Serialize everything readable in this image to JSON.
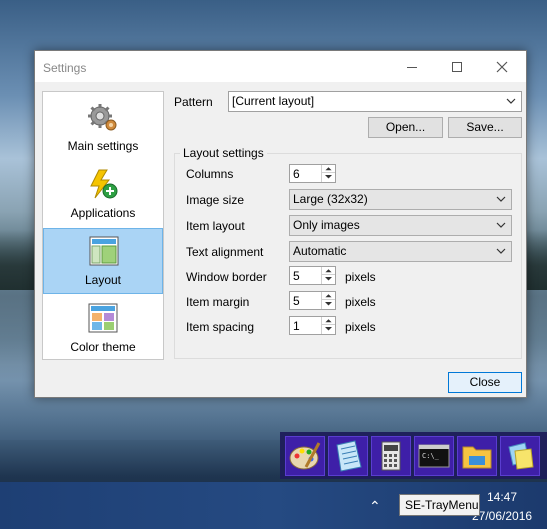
{
  "window": {
    "title": "Settings",
    "minimize_icon": "minimize-icon",
    "maximize_icon": "maximize-icon",
    "close_icon": "close-icon"
  },
  "sidebar": {
    "items": [
      {
        "label": "Main settings",
        "icon": "gears-icon"
      },
      {
        "label": "Applications",
        "icon": "lightning-add-icon"
      },
      {
        "label": "Layout",
        "icon": "layout-icon",
        "selected": true
      },
      {
        "label": "Color theme",
        "icon": "color-palette-icon"
      }
    ]
  },
  "pattern": {
    "label": "Pattern",
    "value": "[Current layout]",
    "open_label": "Open...",
    "save_label": "Save..."
  },
  "layout_settings": {
    "title": "Layout settings",
    "columns": {
      "label": "Columns",
      "value": "6"
    },
    "image_size": {
      "label": "Image size",
      "value": "Large (32x32)"
    },
    "item_layout": {
      "label": "Item layout",
      "value": "Only images"
    },
    "text_alignment": {
      "label": "Text alignment",
      "value": "Automatic"
    },
    "window_border": {
      "label": "Window border",
      "value": "5",
      "unit": "pixels"
    },
    "item_margin": {
      "label": "Item margin",
      "value": "5",
      "unit": "pixels"
    },
    "item_spacing": {
      "label": "Item spacing",
      "value": "1",
      "unit": "pixels"
    }
  },
  "footer": {
    "close_label": "Close"
  },
  "tray_menu": {
    "items": [
      {
        "icon": "paint-palette-icon"
      },
      {
        "icon": "notepad-icon"
      },
      {
        "icon": "calculator-icon"
      },
      {
        "icon": "command-prompt-icon"
      },
      {
        "icon": "file-explorer-icon"
      },
      {
        "icon": "sticky-notes-icon"
      }
    ]
  },
  "taskbar": {
    "time": "14:47",
    "date": "27/06/2016",
    "tooltip": "SE-TrayMenu"
  },
  "colors": {
    "selected_bg": "#aad4f5",
    "accent": "#0078d7",
    "tray_bg": "#3e1fa8",
    "taskbar_bg": "#1f3f74"
  }
}
